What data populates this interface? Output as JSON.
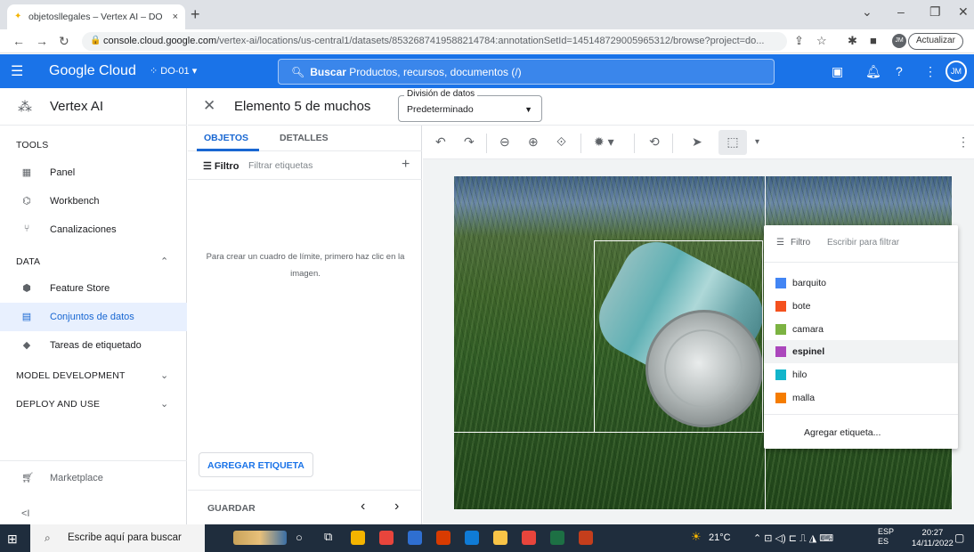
{
  "browser": {
    "tab_title": "objetosllegales – Vertex AI – DO",
    "tab_close": "×",
    "new_tab": "+",
    "url_host": "console.cloud.google.com",
    "url_path": "/vertex-ai/locations/us-central1/datasets/8532687419588214784:annotationSetId=145148729005965312/browse?project=do...",
    "update_label": "Actualizar",
    "profile_initials": "JM"
  },
  "gcloud": {
    "brand": "Google Cloud",
    "project": "DO-01",
    "search_label": "Buscar",
    "search_placeholder": "Productos, recursos, documentos (/)",
    "avatar": "JM"
  },
  "sidebar": {
    "product": "Vertex AI",
    "tools_label": "TOOLS",
    "tools_items": [
      {
        "label": "Panel",
        "icon": "dashboard-icon"
      },
      {
        "label": "Workbench",
        "icon": "workbench-icon"
      },
      {
        "label": "Canalizaciones",
        "icon": "pipelines-icon"
      }
    ],
    "data_label": "DATA",
    "data_items": [
      {
        "label": "Feature Store",
        "icon": "feature-store-icon"
      },
      {
        "label": "Conjuntos de datos",
        "icon": "datasets-icon",
        "active": true
      },
      {
        "label": "Tareas de etiquetado",
        "icon": "labeling-icon"
      }
    ],
    "model_dev_label": "MODEL DEVELOPMENT",
    "deploy_label": "DEPLOY AND USE",
    "marketplace": "Marketplace",
    "collapse": "<I"
  },
  "header": {
    "element_title": "Elemento 5 de muchos",
    "split_label": "División de datos",
    "split_value": "Predeterminado"
  },
  "annotation_panel": {
    "tab_objects": "OBJETOS",
    "tab_details": "DETALLES",
    "filter_label": "Filtro",
    "filter_placeholder": "Filtrar etiquetas",
    "hint": "Para crear un cuadro de límite, primero haz clic en la imagen.",
    "add_label": "AGREGAR ETIQUETA",
    "save": "GUARDAR"
  },
  "label_menu": {
    "filter_label": "Filtro",
    "filter_placeholder": "Escribir para filtrar",
    "labels": [
      {
        "name": "barquito",
        "color": "#4285f4"
      },
      {
        "name": "bote",
        "color": "#f4511e"
      },
      {
        "name": "camara",
        "color": "#7cb342"
      },
      {
        "name": "espinel",
        "color": "#ab47bc",
        "highlighted": true
      },
      {
        "name": "hilo",
        "color": "#12b5cb"
      },
      {
        "name": "malla",
        "color": "#f57c00"
      }
    ],
    "add_label": "Agregar etiqueta..."
  },
  "taskbar": {
    "search_placeholder": "Escribe aquí para buscar",
    "temperature": "21°C",
    "lang1": "ESP",
    "lang2": "ES",
    "time": "20:27",
    "date": "14/11/2022"
  }
}
